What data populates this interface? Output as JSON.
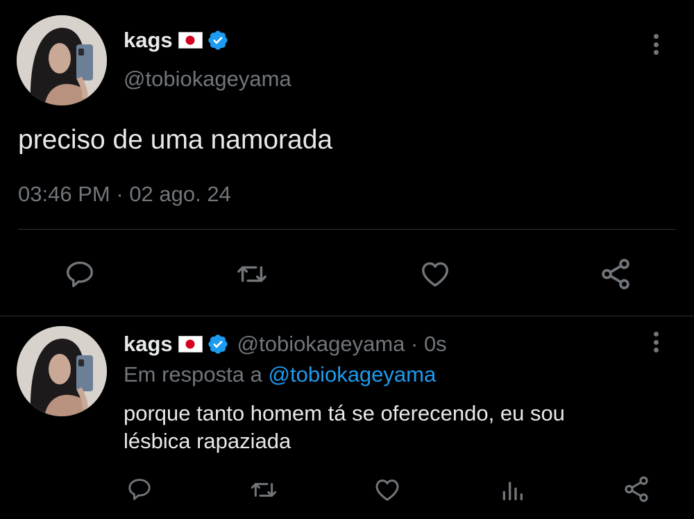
{
  "main_tweet": {
    "display_name": "kags",
    "handle": "@tobiokageyama",
    "text": "preciso de uma namorada",
    "time": "03:46 PM",
    "separator": "·",
    "date": "02 ago. 24"
  },
  "reply_tweet": {
    "display_name": "kags",
    "handle_time": "@tobiokageyama · 0s",
    "reply_prefix": "Em resposta a",
    "reply_to": "@tobiokageyama",
    "text_line1": "porque tanto homem tá se oferecendo, eu sou",
    "text_line2": "lésbica rapaziada"
  },
  "icons": {
    "flag": "japan-flag-icon",
    "verified": "verified-badge-icon",
    "more": "more-vertical-icon",
    "reply": "reply-icon",
    "retweet": "retweet-icon",
    "like": "heart-icon",
    "views": "analytics-icon",
    "share": "share-icon"
  },
  "colors": {
    "background": "#000000",
    "text": "#e7e9ea",
    "muted": "#71767b",
    "accent": "#1d9bf0",
    "flag_red": "#d4001e"
  }
}
